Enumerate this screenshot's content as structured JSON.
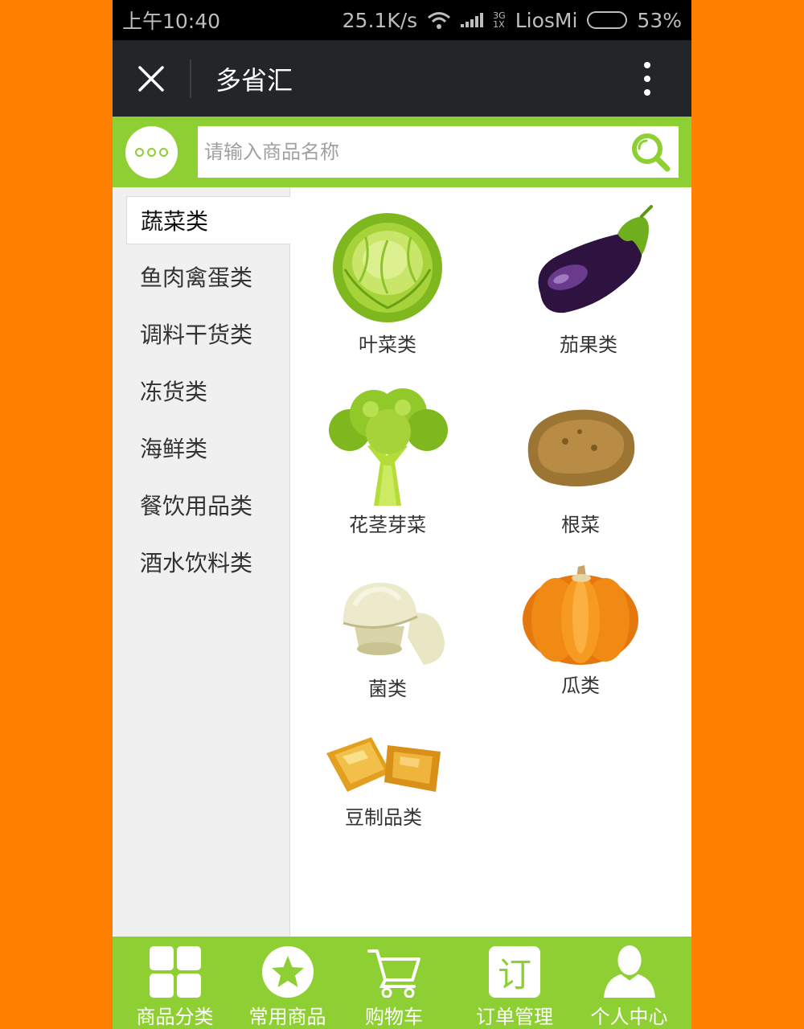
{
  "status_bar": {
    "time": "上午10:40",
    "net_speed": "25.1K/s",
    "net_type_top": "3G",
    "net_type_bottom": "1X",
    "carrier": "LiosMi",
    "battery": "53%"
  },
  "title_bar": {
    "title": "多省汇",
    "icons": [
      "close-icon",
      "more-vertical-icon"
    ]
  },
  "search": {
    "placeholder": "请输入商品名称",
    "value": ""
  },
  "sidebar": {
    "items": [
      {
        "label": "蔬菜类",
        "active": true
      },
      {
        "label": "鱼肉禽蛋类",
        "active": false
      },
      {
        "label": "调料干货类",
        "active": false
      },
      {
        "label": "冻货类",
        "active": false
      },
      {
        "label": "海鲜类",
        "active": false
      },
      {
        "label": "餐饮用品类",
        "active": false
      },
      {
        "label": "酒水饮料类",
        "active": false
      }
    ]
  },
  "products": [
    {
      "label": "叶菜类",
      "icon": "cabbage-icon"
    },
    {
      "label": "茄果类",
      "icon": "eggplant-icon"
    },
    {
      "label": "花茎芽菜",
      "icon": "broccoli-icon"
    },
    {
      "label": "根菜",
      "icon": "potato-icon"
    },
    {
      "label": "菌类",
      "icon": "mushroom-icon"
    },
    {
      "label": "瓜类",
      "icon": "pumpkin-icon"
    },
    {
      "label": "豆制品类",
      "icon": "tofu-icon"
    }
  ],
  "tab_bar": {
    "tabs": [
      {
        "label": "商品分类",
        "icon": "grid-icon"
      },
      {
        "label": "常用商品",
        "icon": "star-icon"
      },
      {
        "label": "购物车",
        "icon": "cart-icon"
      },
      {
        "label": "订单管理",
        "icon": "order-icon",
        "icon_text": "订"
      },
      {
        "label": "个人中心",
        "icon": "user-icon"
      }
    ]
  },
  "colors": {
    "background": "#FF7F00",
    "accent_green": "#8ECF34",
    "title_bar": "#222629",
    "sidebar_bg": "#F0F0F0"
  }
}
